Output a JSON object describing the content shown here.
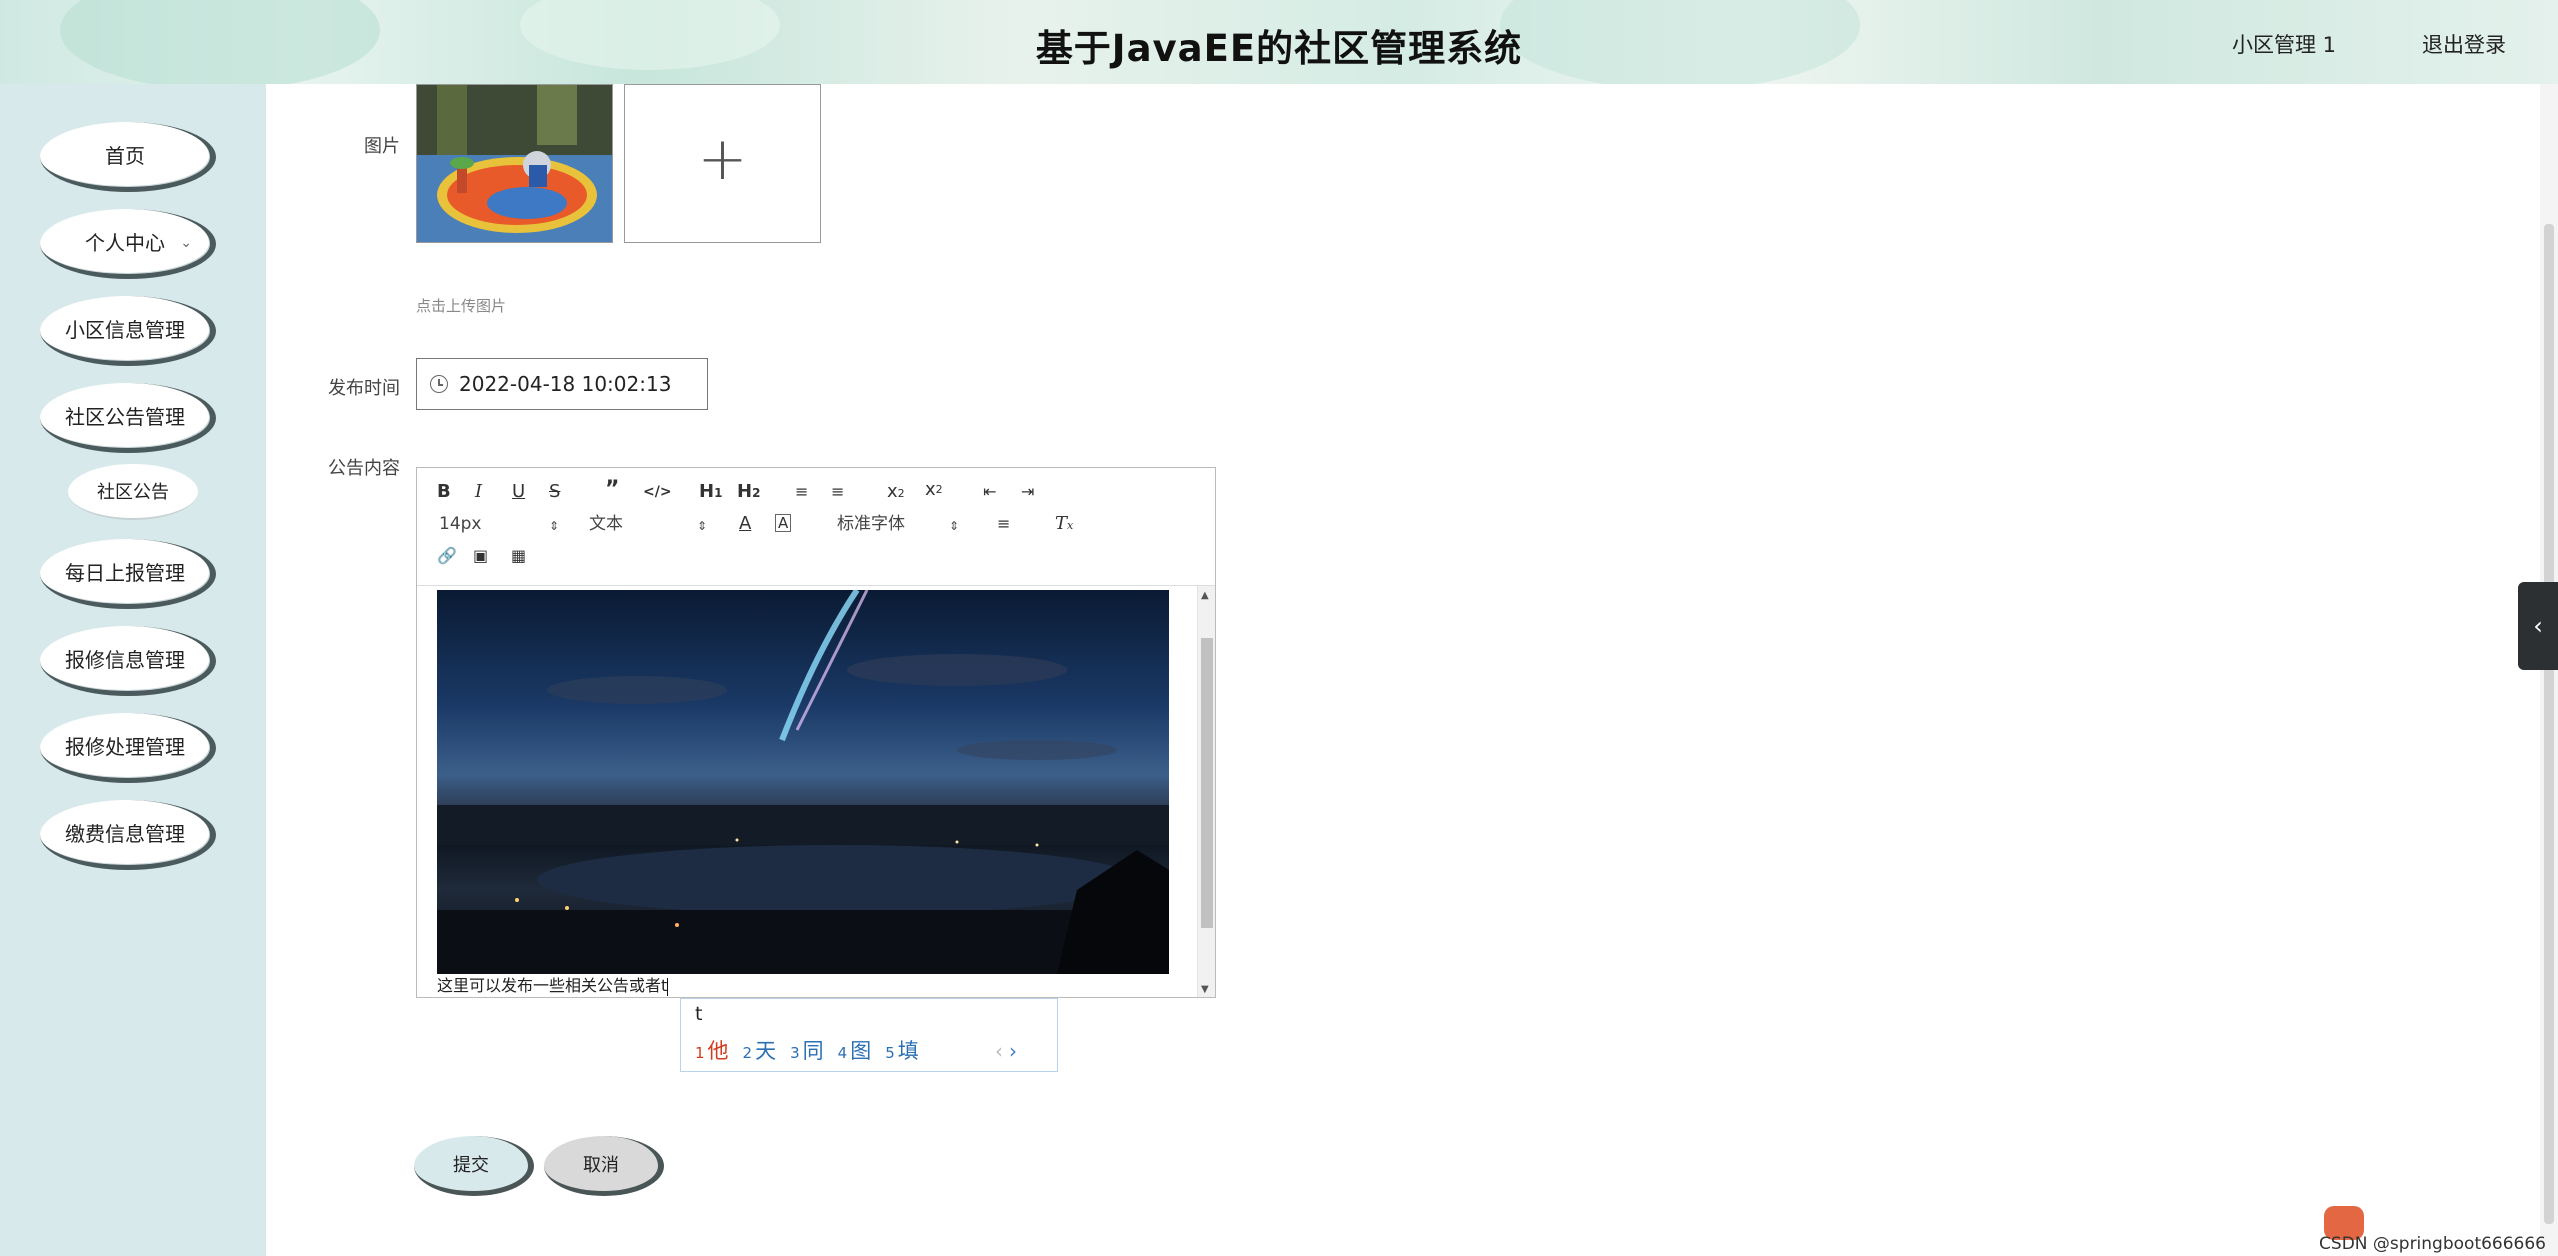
{
  "header": {
    "title": "基于JavaEE的社区管理系统",
    "user": "小区管理 1",
    "logout": "退出登录"
  },
  "sidebar": {
    "items": [
      {
        "label": "首页"
      },
      {
        "label": "个人中心"
      },
      {
        "label": "小区信息管理"
      },
      {
        "label": "社区公告管理"
      },
      {
        "label": "社区公告"
      },
      {
        "label": "每日上报管理"
      },
      {
        "label": "报修信息管理"
      },
      {
        "label": "报修处理管理"
      },
      {
        "label": "缴费信息管理"
      }
    ]
  },
  "form": {
    "image_label": "图片",
    "upload_hint": "点击上传图片",
    "publish_time_label": "发布时间",
    "publish_time_value": "2022-04-18 10:02:13",
    "content_label": "公告内容",
    "editor": {
      "font_size": "14px",
      "text_type": "文本",
      "font_family": "标准字体",
      "caption": "这里可以发布一些相关公告或者t"
    },
    "submit": "提交",
    "cancel": "取消"
  },
  "ime": {
    "input": "t",
    "candidates": [
      {
        "num": "1",
        "text": "他"
      },
      {
        "num": "2",
        "text": "天"
      },
      {
        "num": "3",
        "text": "同"
      },
      {
        "num": "4",
        "text": "图"
      },
      {
        "num": "5",
        "text": "填"
      }
    ]
  },
  "watermark": "CSDN @springboot666666",
  "colors": {
    "sidebar_bg": "#d8e9ec",
    "pill_border": "#4b5a5c",
    "submit_bg": "#d8e9ec",
    "cancel_bg": "#d9d9d9",
    "ime_first": "#d23b1e",
    "ime_cand": "#2b6fb4"
  }
}
